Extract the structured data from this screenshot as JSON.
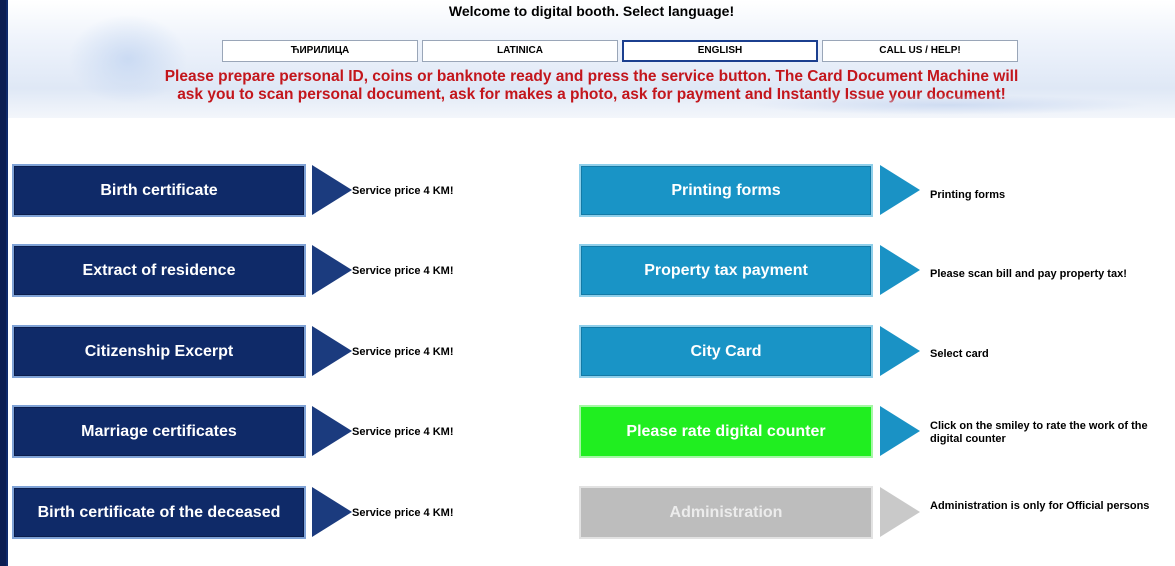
{
  "header": {
    "welcome": "Welcome to digital booth. Select language!",
    "languages": [
      "ЋИРИЛИЦА",
      "LATINICA",
      "ENGLISH",
      "CALL US / HELP!"
    ],
    "active_language": "ENGLISH",
    "notice_line1": "Please prepare personal ID, coins or banknote ready and press the service button. The Card Document Machine will",
    "notice_line2": "ask you to scan personal document, ask for makes a photo, ask for payment and Instantly Issue your document!"
  },
  "colors": {
    "navy": "#0f2a68",
    "teal": "#1994c6",
    "green": "#20ee20",
    "gray": "#bdbdbd",
    "notice_red": "#c3161c"
  },
  "left_services": [
    {
      "label": "Birth certificate",
      "desc": "Service price 4 KM!"
    },
    {
      "label": "Extract of residence",
      "desc": "Service price 4 KM!"
    },
    {
      "label": "Citizenship Excerpt",
      "desc": "Service price 4 KM!"
    },
    {
      "label": "Marriage certificates",
      "desc": "Service price 4 KM!"
    },
    {
      "label": "Birth certificate of the deceased",
      "desc": "Service price 4 KM!"
    }
  ],
  "right_services": [
    {
      "label": "Printing forms",
      "desc": "Printing forms",
      "style": "teal"
    },
    {
      "label": "Property tax payment",
      "desc": "Please scan bill and pay property tax!",
      "style": "teal"
    },
    {
      "label": "City Card",
      "desc": "Select card",
      "style": "teal"
    },
    {
      "label": "Please rate digital counter",
      "desc": "Click on the smiley to rate the work of the digital counter",
      "style": "green"
    },
    {
      "label": "Administration",
      "desc": "Administration is only for Official persons",
      "style": "gray"
    }
  ]
}
